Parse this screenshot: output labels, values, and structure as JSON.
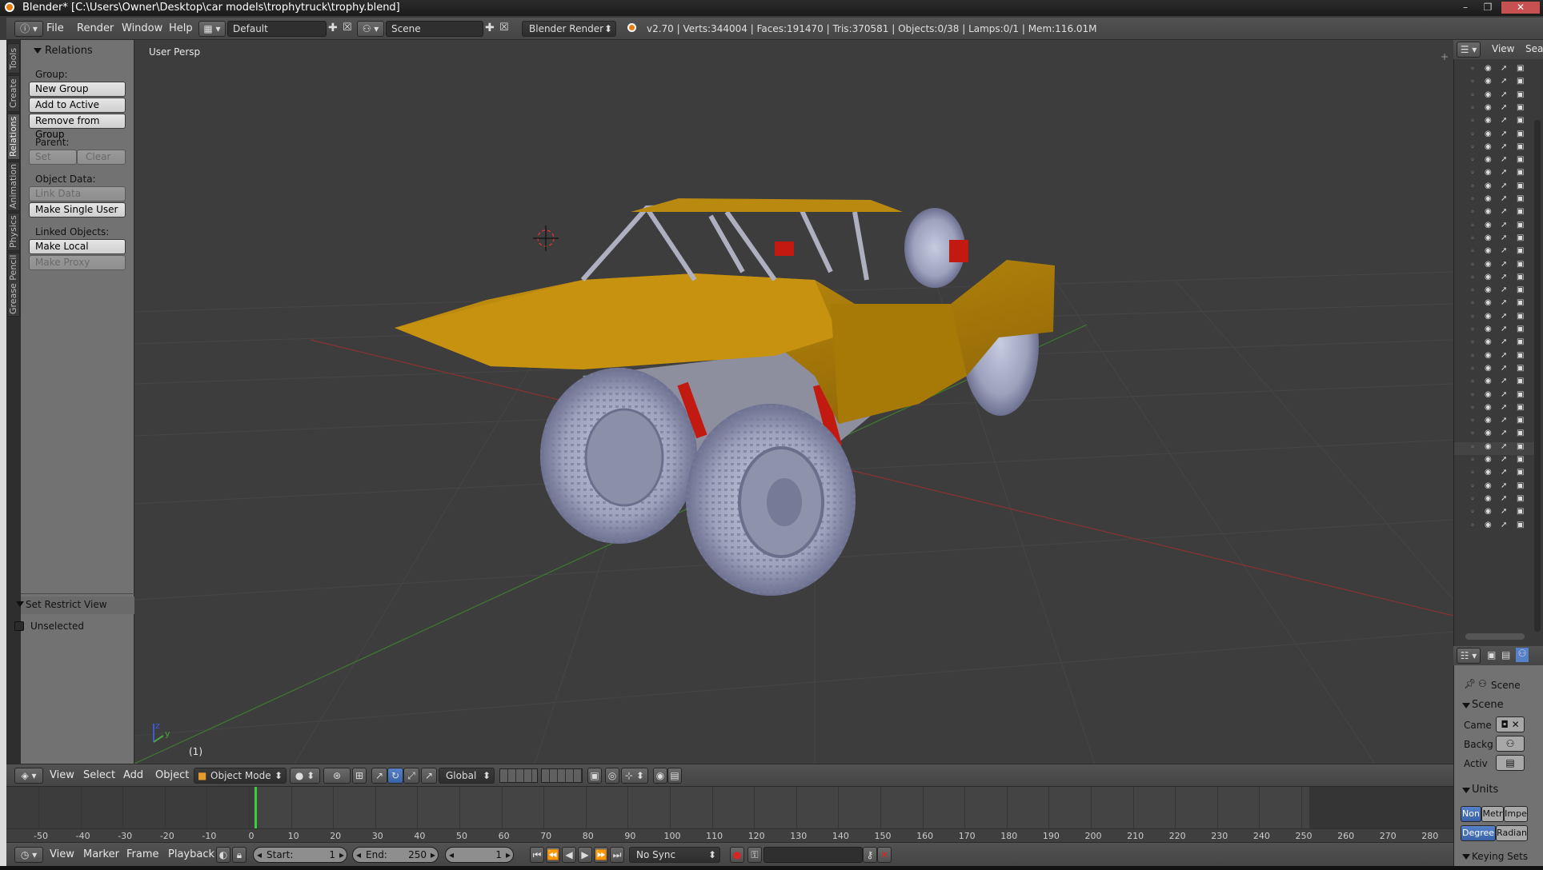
{
  "window": {
    "title": "Blender* [C:\\Users\\Owner\\Desktop\\car models\\trophytruck\\trophy.blend]",
    "controls": [
      "–",
      "❐",
      "✕"
    ]
  },
  "info_header": {
    "menus": [
      "File",
      "Render",
      "Window",
      "Help"
    ],
    "screen_layout": "Default",
    "scene": "Scene",
    "render_engine": "Blender Render",
    "stats": "v2.70 | Verts:344004 | Faces:191470 | Tris:370581 | Objects:0/38 | Lamps:0/1 | Mem:116.01M"
  },
  "vertical_tabs": [
    "Tools",
    "Create",
    "Relations",
    "Animation",
    "Physics",
    "Grease Pencil"
  ],
  "tool_panel": {
    "relations_header": "Relations",
    "group_label": "Group:",
    "new_group": "New Group",
    "add_to_active": "Add to Active",
    "remove_from_group": "Remove from Group",
    "parent_label": "Parent:",
    "set": "Set",
    "clear": "Clear",
    "object_data_label": "Object Data:",
    "link_data": "Link Data",
    "make_single_user": "Make Single User",
    "linked_objects_label": "Linked Objects:",
    "make_local": "Make Local",
    "make_proxy": "Make Proxy",
    "restrict_header": "Set Restrict View",
    "unselected": "Unselected"
  },
  "viewport": {
    "view_label": "User Persp",
    "frame_label": "(1)",
    "axis_z": "z",
    "axis_y": "y",
    "body_color": "#b8860b",
    "tire_color": "#9a9fb8"
  },
  "view3d_header": {
    "menus": [
      "View",
      "Select",
      "Add",
      "Object"
    ],
    "mode": "Object Mode",
    "orientation": "Global"
  },
  "timeline": {
    "ticks": [
      "-50",
      "-40",
      "-30",
      "-20",
      "-10",
      "0",
      "10",
      "20",
      "30",
      "40",
      "50",
      "60",
      "70",
      "80",
      "90",
      "100",
      "110",
      "120",
      "130",
      "140",
      "150",
      "160",
      "170",
      "180",
      "190",
      "200",
      "210",
      "220",
      "230",
      "240",
      "250",
      "260",
      "270",
      "280"
    ],
    "menus": [
      "View",
      "Marker",
      "Frame",
      "Playback"
    ],
    "start_label": "Start:",
    "start_value": "1",
    "end_label": "End:",
    "end_value": "250",
    "current_frame": "1",
    "sync": "No Sync"
  },
  "outliner": {
    "view_menu": "View",
    "search_label": "Sea"
  },
  "properties": {
    "scene_breadcrumb": "Scene",
    "scene_header": "Scene",
    "camera_label": "Came",
    "background_label": "Backg",
    "active_label": "Activ",
    "units_header": "Units",
    "unit_none": "Non",
    "unit_metric": "Metr",
    "unit_imperial": "Impe",
    "rot_degrees": "Degree",
    "rot_radians": "Radian",
    "keying_header": "Keying Sets"
  }
}
